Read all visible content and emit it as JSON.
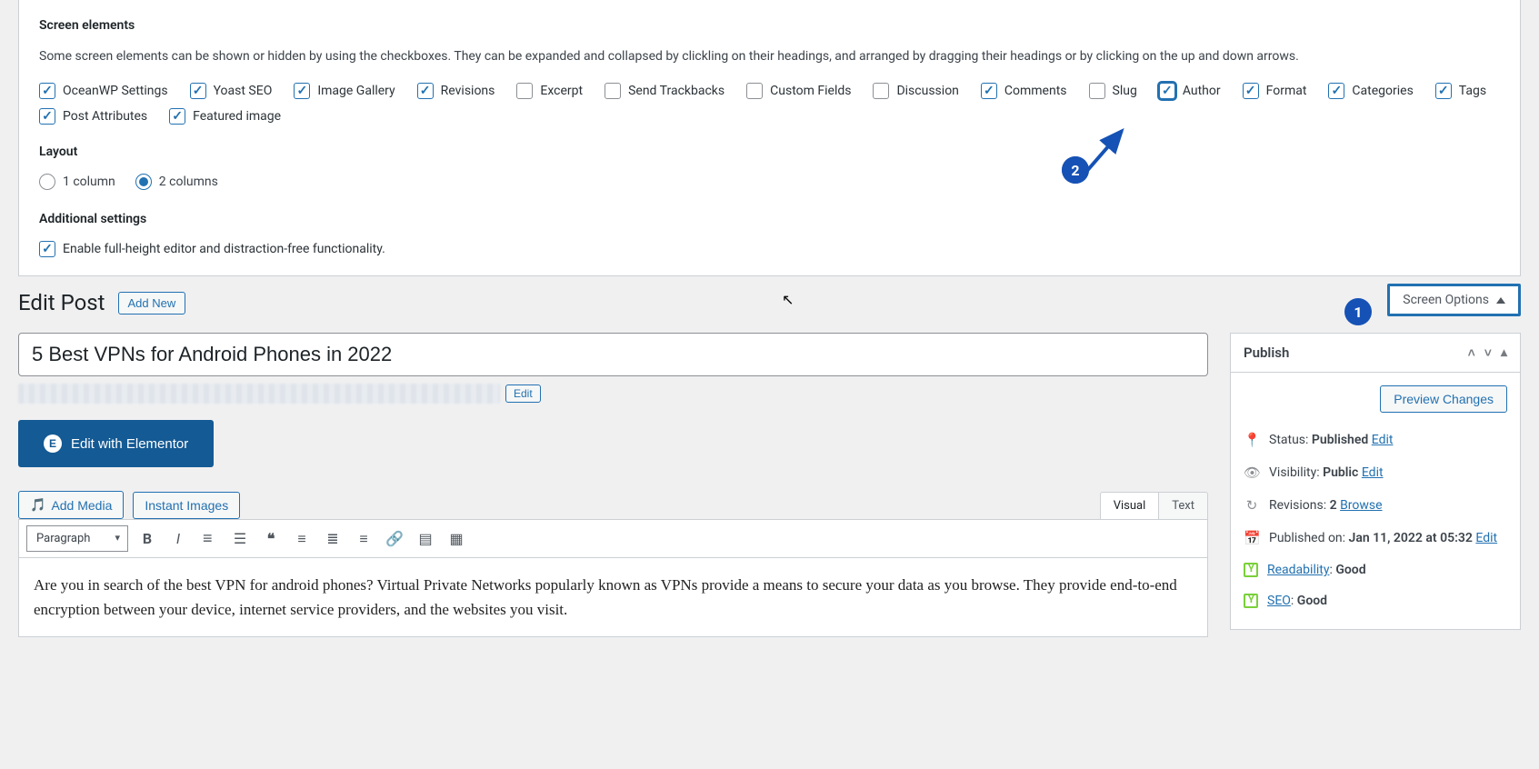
{
  "screenElements": {
    "title": "Screen elements",
    "desc": "Some screen elements can be shown or hidden by using the checkboxes. They can be expanded and collapsed by clickling on their headings, and arranged by dragging their headings or by clicking on the up and down arrows.",
    "items": [
      {
        "label": "OceanWP Settings",
        "checked": true,
        "hl": false
      },
      {
        "label": "Yoast SEO",
        "checked": true,
        "hl": false
      },
      {
        "label": "Image Gallery",
        "checked": true,
        "hl": false
      },
      {
        "label": "Revisions",
        "checked": true,
        "hl": false
      },
      {
        "label": "Excerpt",
        "checked": false,
        "hl": false
      },
      {
        "label": "Send Trackbacks",
        "checked": false,
        "hl": false
      },
      {
        "label": "Custom Fields",
        "checked": false,
        "hl": false
      },
      {
        "label": "Discussion",
        "checked": false,
        "hl": false
      },
      {
        "label": "Comments",
        "checked": true,
        "hl": false
      },
      {
        "label": "Slug",
        "checked": false,
        "hl": false
      },
      {
        "label": "Author",
        "checked": true,
        "hl": true
      },
      {
        "label": "Format",
        "checked": true,
        "hl": false
      },
      {
        "label": "Categories",
        "checked": true,
        "hl": false
      },
      {
        "label": "Tags",
        "checked": true,
        "hl": false
      },
      {
        "label": "Post Attributes",
        "checked": true,
        "hl": false
      },
      {
        "label": "Featured image",
        "checked": true,
        "hl": false
      }
    ]
  },
  "layout": {
    "title": "Layout",
    "options": [
      {
        "label": "1 column",
        "checked": false
      },
      {
        "label": "2 columns",
        "checked": true
      }
    ]
  },
  "additional": {
    "title": "Additional settings",
    "item": {
      "label": "Enable full-height editor and distraction-free functionality.",
      "checked": true
    }
  },
  "screenOptionsTab": "Screen Options",
  "pageTitle": "Edit Post",
  "addNew": "Add New",
  "postTitle": "5 Best VPNs for Android Phones in 2022",
  "permalinkEdit": "Edit",
  "elementorBtn": "Edit with Elementor",
  "addMedia": "Add Media",
  "instantImages": "Instant Images",
  "tabs": {
    "visual": "Visual",
    "text": "Text"
  },
  "paragraphDD": "Paragraph",
  "editorContent": "Are you in search of the best VPN for android phones? Virtual Private Networks popularly known as VPNs provide a means to secure your data as you browse. They provide end-to-end encryption between your device, internet service providers, and the websites you visit.",
  "publish": {
    "heading": "Publish",
    "preview": "Preview Changes",
    "statusLabel": "Status:",
    "statusValue": "Published",
    "visibilityLabel": "Visibility:",
    "visibilityValue": "Public",
    "revisionsLabel": "Revisions:",
    "revisionsValue": "2",
    "browse": "Browse",
    "publishedOnLabel": "Published on:",
    "publishedOnValue": "Jan 11, 2022 at 05:32",
    "readabilityLabel": "Readability",
    "readabilityValue": "Good",
    "seoLabel": "SEO",
    "seoValue": "Good",
    "edit": "Edit"
  },
  "badges": {
    "one": "1",
    "two": "2"
  }
}
